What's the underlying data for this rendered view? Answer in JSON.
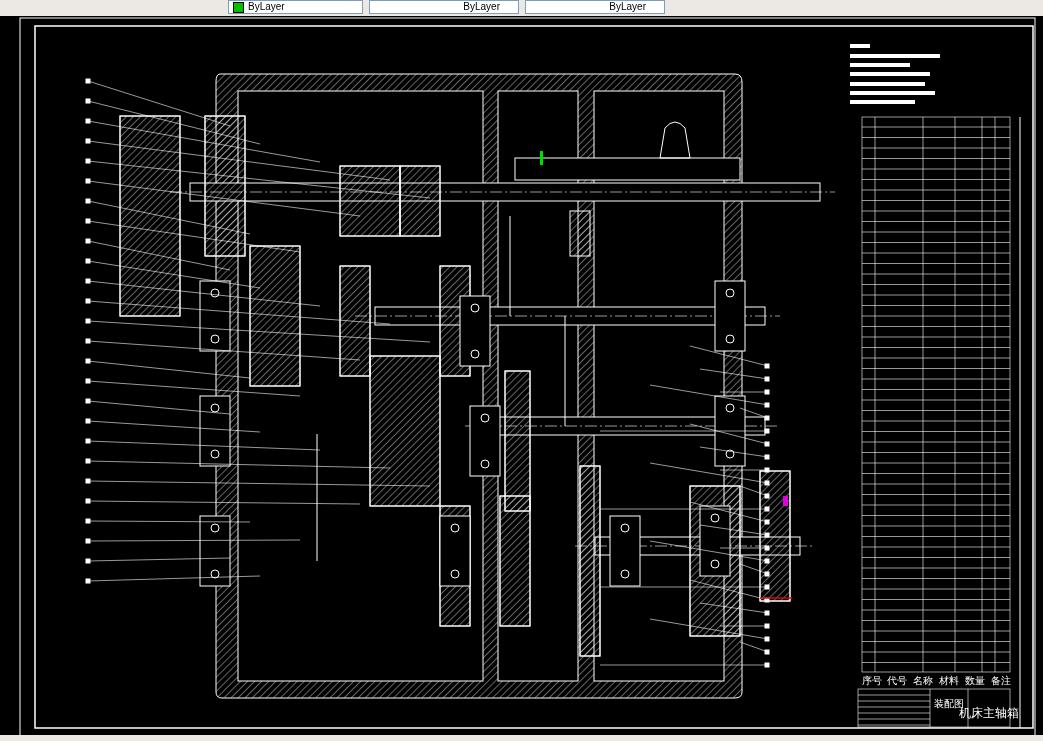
{
  "toolbar": {
    "dropdowns": [
      {
        "kind": "color",
        "value": "ByLayer"
      },
      {
        "kind": "linetype",
        "value": "ByLayer"
      },
      {
        "kind": "lineweight",
        "value": "ByLayer"
      }
    ]
  },
  "drawing": {
    "title": "机床主轴箱",
    "drawing_type": "装配图",
    "parts_list_header": [
      "序号",
      "代号",
      "名称",
      "材料",
      "数量",
      "备注"
    ]
  }
}
